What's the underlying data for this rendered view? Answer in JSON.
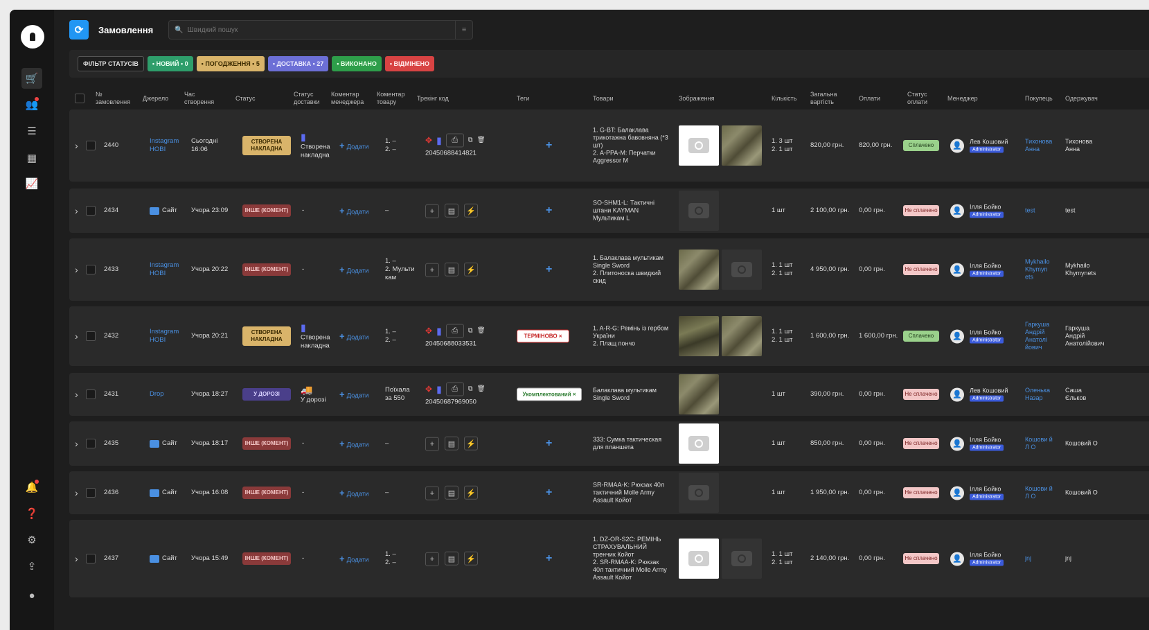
{
  "sidebar": {
    "icons": [
      "cart-icon",
      "users-bell-icon",
      "list-check-icon",
      "warehouse-icon",
      "chart-icon",
      "bell-icon",
      "help-icon",
      "gear-icon",
      "export-icon",
      "user-icon"
    ]
  },
  "header": {
    "title": "Замовлення",
    "search_placeholder": "Швидкий пошук"
  },
  "filters": {
    "filter_label": "ФІЛЬТР СТАТУСІВ",
    "chips": [
      {
        "label": "• НОВИЙ • 0",
        "bg": "#2e9e6b",
        "color": "#eafff2"
      },
      {
        "label": "• ПОГОДЖЕННЯ • 5",
        "bg": "#d9b46a",
        "color": "#3a2a00"
      },
      {
        "label": "• ДОСТАВКА • 27",
        "bg": "#6c6fd6",
        "color": "#eeeeff"
      },
      {
        "label": "• ВИКОНАНО",
        "bg": "#2e9e4a",
        "color": "#eaffea"
      },
      {
        "label": "• ВІДМІНЕНО",
        "bg": "#d84343",
        "color": "#ffecec"
      }
    ]
  },
  "columns": {
    "order_no": "№ замовлення",
    "source": "Джерело",
    "created": "Час створення",
    "status": "Статус",
    "delivery_status": "Статус доставки",
    "manager_comment": "Коментар менеджера",
    "product_comment": "Коментар товару",
    "tracking": "Трекінг код",
    "tags": "Теги",
    "products": "Товари",
    "images": "Зображення",
    "quantity": "Кількість",
    "total": "Загальна вартість",
    "payments": "Оплати",
    "pay_status": "Статус оплати",
    "manager": "Менеджер",
    "buyer": "Покупець",
    "recipient": "Одержувач"
  },
  "rows": [
    {
      "id": "2440",
      "source": "Instagram НОВІ",
      "source_type": "link",
      "created": "Сьогодні 16:06",
      "status": "СТВОРЕНА НАКЛАДНА",
      "status_class": "st-created",
      "delivery": "Створена накладна",
      "mgr_comment": "Додати",
      "prod_comment": "1. –\n2. –",
      "tracking": "20450688414821",
      "tracking_full": true,
      "tag": "",
      "products": "1. G-BT: Балаклава трикотажна бавовняна (*3 шт)\n2. A-PPA-M: Перчатки Aggressor M",
      "images": [
        "white",
        "photo"
      ],
      "qty": "1. 3 шт\n2. 1 шт",
      "total": "820,00 грн.",
      "paid": "820,00 грн.",
      "pay_status": "Сплачено",
      "pay_ok": true,
      "manager": "Лев Кошовий",
      "role": "Administrator",
      "buyer": "Тихонова Анна",
      "recipient": "Тихонова Анна"
    },
    {
      "id": "2434",
      "source": "Сайт",
      "source_type": "site",
      "created": "Учора 23:09",
      "status": "ІНШЕ (КОМЕНТ)",
      "status_class": "st-other",
      "delivery": "-",
      "mgr_comment": "Додати",
      "prod_comment": "–",
      "tracking": "",
      "tracking_full": false,
      "tag": "",
      "products": "SO-SHM1-L: Тактичні штани KAYMAN Мультикам L",
      "images": [
        "dark"
      ],
      "qty": "1 шт",
      "total": "2 100,00 грн.",
      "paid": "0,00 грн.",
      "pay_status": "Не сплачено",
      "pay_ok": false,
      "manager": "Ілля Бойко",
      "role": "Administrator",
      "buyer": "test",
      "recipient": "test"
    },
    {
      "id": "2433",
      "source": "Instagram НОВІ",
      "source_type": "link",
      "created": "Учора 20:22",
      "status": "ІНШЕ (КОМЕНТ)",
      "status_class": "st-other",
      "delivery": "-",
      "mgr_comment": "Додати",
      "prod_comment": "1. –\n2. Мульти кам",
      "tracking": "",
      "tracking_full": false,
      "tag": "",
      "products": "1. Балаклава мультикам Single Sword\n2. Плитоноска швидкий скид",
      "images": [
        "photo",
        "dark"
      ],
      "qty": "1. 1 шт\n2. 1 шт",
      "total": "4 950,00 грн.",
      "paid": "0,00 грн.",
      "pay_status": "Не сплачено",
      "pay_ok": false,
      "manager": "Ілля Бойко",
      "role": "Administrator",
      "buyer": "Mykhailo Khymyn ets",
      "recipient": "Mykhailo Khymynets"
    },
    {
      "id": "2432",
      "source": "Instagram НОВІ",
      "source_type": "link",
      "created": "Учора 20:21",
      "status": "СТВОРЕНА НАКЛАДНА",
      "status_class": "st-created",
      "delivery": "Створена накладна",
      "mgr_comment": "Додати",
      "prod_comment": "1. –\n2. –",
      "tracking": "20450688033531",
      "tracking_full": true,
      "tag": "ТЕРМІНОВО ×",
      "tag_class": "tag-red",
      "products": "1. A-R-G: Ремінь із гербом України\n2. Плащ пончо",
      "images": [
        "photo2",
        "photo"
      ],
      "qty": "1. 1 шт\n2. 1 шт",
      "total": "1 600,00 грн.",
      "paid": "1 600,00 грн.",
      "pay_status": "Сплачено",
      "pay_ok": true,
      "manager": "Ілля Бойко",
      "role": "Administrator",
      "buyer": "Гаркуша Андрій Анатолі йович",
      "recipient": "Гаркуша Андрій Анатолійович"
    },
    {
      "id": "2431",
      "source": "Drop",
      "source_type": "link",
      "created": "Учора 18:27",
      "status": "У ДОРОЗІ",
      "status_class": "st-road",
      "delivery": "У дорозі",
      "mgr_comment": "Додати",
      "prod_comment": "Поїхала за 550",
      "tracking": "20450687969050",
      "tracking_full": true,
      "tag": "Укомплектований ×",
      "tag_class": "tag-green",
      "products": "Балаклава мультикам Single Sword",
      "images": [
        "photo"
      ],
      "qty": "1 шт",
      "total": "390,00 грн.",
      "paid": "0,00 грн.",
      "pay_status": "Не сплачено",
      "pay_ok": false,
      "manager": "Лев Кошовий",
      "role": "Administrator",
      "buyer": "Оленька Назар",
      "recipient": "Саша Єльков"
    },
    {
      "id": "2435",
      "source": "Сайт",
      "source_type": "site",
      "created": "Учора 18:17",
      "status": "ІНШЕ (КОМЕНТ)",
      "status_class": "st-other",
      "delivery": "-",
      "mgr_comment": "Додати",
      "prod_comment": "–",
      "tracking": "",
      "tracking_full": false,
      "tag": "",
      "products": "333: Сумка тактическая для планшета",
      "images": [
        "white"
      ],
      "qty": "1 шт",
      "total": "850,00 грн.",
      "paid": "0,00 грн.",
      "pay_status": "Не сплачено",
      "pay_ok": false,
      "manager": "Ілля Бойко",
      "role": "Administrator",
      "buyer": "Кошови й Л О",
      "recipient": "Кошовий О"
    },
    {
      "id": "2436",
      "source": "Сайт",
      "source_type": "site",
      "created": "Учора 16:08",
      "status": "ІНШЕ (КОМЕНТ)",
      "status_class": "st-other",
      "delivery": "-",
      "mgr_comment": "Додати",
      "prod_comment": "–",
      "tracking": "",
      "tracking_full": false,
      "tag": "",
      "products": "SR-RMAA-K: Рюкзак 40л тактичний Molle Army Assault Койот",
      "images": [
        "dark"
      ],
      "qty": "1 шт",
      "total": "1 950,00 грн.",
      "paid": "0,00 грн.",
      "pay_status": "Не сплачено",
      "pay_ok": false,
      "manager": "Ілля Бойко",
      "role": "Administrator",
      "buyer": "Кошови й Л О",
      "recipient": "Кошовий О"
    },
    {
      "id": "2437",
      "source": "Сайт",
      "source_type": "site",
      "created": "Учора 15:49",
      "status": "ІНШЕ (КОМЕНТ)",
      "status_class": "st-other",
      "delivery": "-",
      "mgr_comment": "Додати",
      "prod_comment": "1. –\n2. –",
      "tracking": "",
      "tracking_full": false,
      "tag": "",
      "products": "1. DZ-OR-S2C: РЕМІНЬ СТРАХУВАЛЬНИЙ тренчик Койот\n2. SR-RMAA-K: Рюкзак 40л тактичний Molle Army Assault Койот",
      "images": [
        "white",
        "dark"
      ],
      "qty": "1. 1 шт\n2. 1 шт",
      "total": "2 140,00 грн.",
      "paid": "0,00 грн.",
      "pay_status": "Не сплачено",
      "pay_ok": false,
      "manager": "Ілля Бойко",
      "role": "Administrator",
      "buyer": "jnj",
      "recipient": "jnj"
    }
  ]
}
